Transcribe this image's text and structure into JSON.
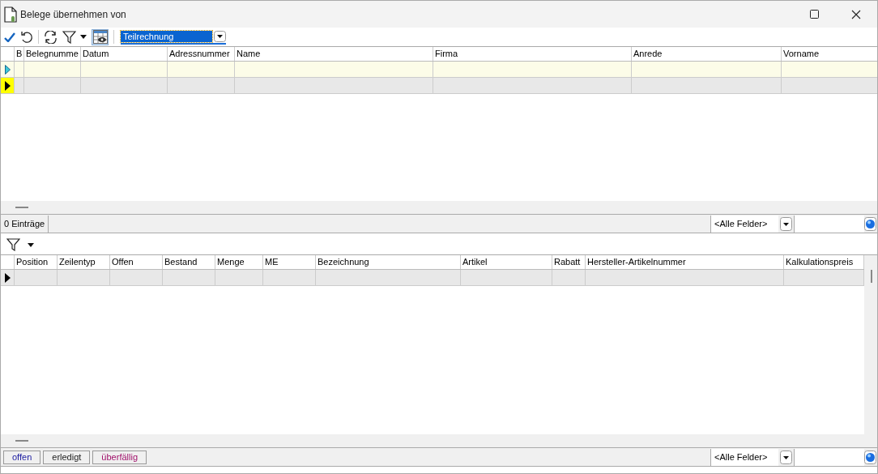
{
  "window": {
    "title": "Belege übernehmen von"
  },
  "toolbar": {
    "view_button_pressed": true,
    "document_type": {
      "value": "Teilrechnung",
      "selected": true
    }
  },
  "top_grid": {
    "columns": [
      "B",
      "Belegnumme",
      "Datum",
      "Adressnummer",
      "Name",
      "Firma",
      "Anrede",
      "Vorname"
    ],
    "rows": [
      {
        "kind": "filter",
        "selected": false
      },
      {
        "kind": "data",
        "selected": true
      }
    ]
  },
  "top_status": {
    "count": "0 Einträge",
    "field_select": "<Alle Felder>"
  },
  "bottom_grid": {
    "columns": [
      "Position",
      "Zeilentyp",
      "Offen",
      "Bestand",
      "Menge",
      "ME",
      "Bezeichnung",
      "Artikel",
      "Rabatt",
      "Hersteller-Artikelnummer",
      "Kalkulationspreis"
    ],
    "rows": [
      {
        "kind": "data",
        "selected": false
      }
    ]
  },
  "bottom_status": {
    "filters": [
      {
        "label": "offen",
        "color": "#1a1aa0"
      },
      {
        "label": "erledigt",
        "color": "#202020"
      },
      {
        "label": "überfällig",
        "color": "#a0106a"
      }
    ],
    "field_select": "<Alle Felder>"
  }
}
